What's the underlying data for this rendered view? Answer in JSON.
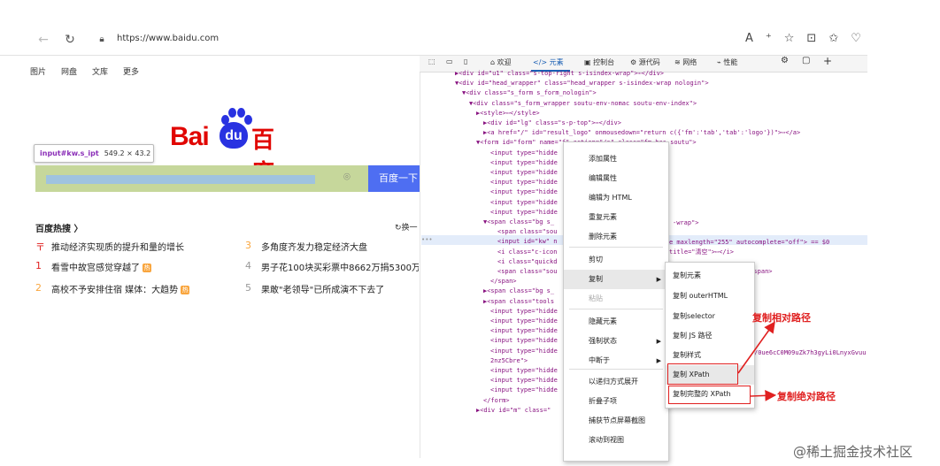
{
  "browser": {
    "url": "https://www.baidu.com",
    "back_icon": "back-arrow-icon",
    "forward_icon": "forward-arrow-icon",
    "reload_icon": "reload-icon",
    "toolbar_icons": [
      "A⁺",
      "☆",
      "⊡",
      "✩",
      "♡"
    ]
  },
  "page": {
    "top_nav": [
      "图片",
      "网盘",
      "文库",
      "更多"
    ],
    "logo": {
      "bai": "Bai",
      "du": "du",
      "cn": "百度"
    },
    "tooltip": {
      "selector": "input#kw.s_ipt",
      "size": "549.2 × 43.2"
    },
    "search_button": "百度一下",
    "hot_title": "百度热搜",
    "hot_refresh": "换一",
    "hot_left": [
      {
        "num": "〒",
        "text": "推动经济实现质的提升和量的增长",
        "tag": ""
      },
      {
        "num": "1",
        "text": "看雪中故宫感觉穿越了",
        "tag": "热"
      },
      {
        "num": "2",
        "text": "高校不予安排住宿 媒体：大趋势",
        "tag": "热"
      }
    ],
    "hot_right": [
      {
        "num": "3",
        "text": "多角度齐发力稳定经济大盘"
      },
      {
        "num": "4",
        "text": "男子花100块买彩票中8662万捐5300万"
      },
      {
        "num": "5",
        "text": "果敢\"老领导\"已所成演不下去了"
      }
    ],
    "colors": {
      "hot_num_red": "#e02020",
      "hot_num_orange": "#f9a53d",
      "search_button": "#4e6ef2"
    }
  },
  "devtools": {
    "tabs": [
      "欢迎",
      "</> 元素",
      "控制台",
      "源代码",
      "网络",
      "性能"
    ],
    "active_tab": "</> 元素",
    "code_lines": [
      "▶<div id=\"u1\" class=\"s-top-right s-isindex-wrap\">⋯</div>",
      "▼<div id=\"head_wrapper\" class=\"head_wrapper s-isindex-wrap nologin\">",
      "▼<div class=\"s_form s_form_nologin\">",
      "▼<div class=\"s_form_wrapper soutu-env-nomac soutu-env-index\">",
      "▶<style>⋯</style>",
      "▶<div id=\"lg\" class=\"s-p-top\">⋯</div>",
      "▶<a href=\"/\" id=\"result_logo\" onmousedown=\"return c({'fm':'tab','tab':'logo'})\">⋯</a>",
      "▼<form id=\"form\" name=\"f\" action=\"/s\" class=\"fm  has-soutu\">",
      "<input type=\"hidde",
      "<input type=\"hidde",
      "<input type=\"hidde",
      "<input type=\"hidde",
      "<input type=\"hidde",
      "<input type=\"hidde",
      "<input type=\"hidde",
      "▼<span class=\"bg s_",
      "<span class=\"sou",
      "<input id=\"kw\" n",
      "<i class=\"c-icon",
      "<i class=\"quickd",
      "<span class=\"sou",
      "</span>",
      "▶<span class=\"bg s_",
      "▶<span class=\"tools",
      "<input type=\"hidde",
      "<input type=\"hidde",
      "<input type=\"hidde",
      "<input type=\"hidde",
      "<input type=\"hidde",
      "2nz5Cbre\">",
      "<input type=\"hidde",
      "<input type=\"hidde",
      "<input type=\"hidde",
      "</form>",
      "▶<div id=\"m\" class=\""
    ],
    "code_right": [
      "-wrap\">",
      "e maxlength=\"255\" autocomplete=\"off\"> == $0",
      "title=\"清空\">⋯</i>",
      "素</span>",
      "/0ue6cC0M09uZk7h3gyLi0LnyxGvuu"
    ]
  },
  "context_menu": {
    "items": [
      "添加属性",
      "编辑属性",
      "编辑为 HTML",
      "重复元素",
      "删除元素",
      "剪切",
      "复制",
      "粘贴",
      "隐藏元素",
      "强制状态",
      "中断于",
      "以递归方式展开",
      "折叠子项",
      "捕获节点屏幕截图",
      "滚动到视图"
    ],
    "highlighted": "复制",
    "submenu": [
      "复制元素",
      "复制 outerHTML",
      "复制selector",
      "复制 JS 路径",
      "复制样式",
      "复制 XPath",
      "复制完整的 XPath"
    ]
  },
  "annotations": {
    "relative": "复制相对路径",
    "absolute": "复制绝对路径"
  },
  "watermark": "@稀土掘金技术社区"
}
